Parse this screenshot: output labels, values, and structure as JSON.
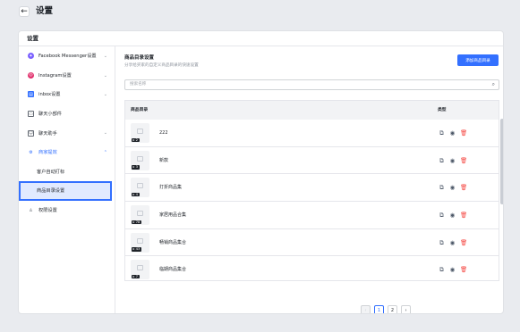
{
  "topbar": {
    "back_icon": "arrow-left-icon",
    "title": "设置"
  },
  "card": {
    "header": "设置"
  },
  "sidebar": {
    "items": [
      {
        "label": "Facebook Messenger设置",
        "icon": "messenger-icon",
        "color": "#7b61ff",
        "has_chevron": true
      },
      {
        "label": "Instagram设置",
        "icon": "instagram-icon",
        "color": "#e1306c",
        "has_chevron": true
      },
      {
        "label": "inbox设置",
        "icon": "inbox-icon",
        "color": "#3370ff",
        "has_chevron": true
      },
      {
        "label": "聊天小部件",
        "icon": "chat-widget-icon",
        "color": "#646a73",
        "has_chevron": false
      },
      {
        "label": "聊天助手",
        "icon": "assistant-icon",
        "color": "#646a73",
        "has_chevron": true
      },
      {
        "label": "商家提效",
        "icon": "efficiency-icon",
        "color": "#3370ff",
        "has_chevron": true,
        "expanded": true
      }
    ],
    "sub_items": [
      {
        "label": "客户自动打标"
      },
      {
        "label": "商品目录设置",
        "selected": true
      }
    ],
    "last_item": {
      "label": "权限设置",
      "icon": "permission-icon"
    }
  },
  "main": {
    "title": "商品目录设置",
    "subtitle": "分享给买家的自定义商品目录的快速设置",
    "add_button": "添加商品目录",
    "search_placeholder": "搜索名称",
    "table": {
      "col_name": "商品目录",
      "col_type": "类型",
      "rows": [
        {
          "name": "222",
          "count": "2"
        },
        {
          "name": "新款",
          "count": "3"
        },
        {
          "name": "打折商品集",
          "count": "4"
        },
        {
          "name": "家居用品合集",
          "count": "78"
        },
        {
          "name": "畅销商品集合",
          "count": "43"
        },
        {
          "name": "临期商品集合",
          "count": "7"
        }
      ]
    },
    "pagination": {
      "prev": "‹",
      "pages": [
        "1",
        "2"
      ],
      "next": "›",
      "current": "1"
    }
  },
  "colors": {
    "accent": "#3370ff",
    "danger": "#f54a45"
  }
}
